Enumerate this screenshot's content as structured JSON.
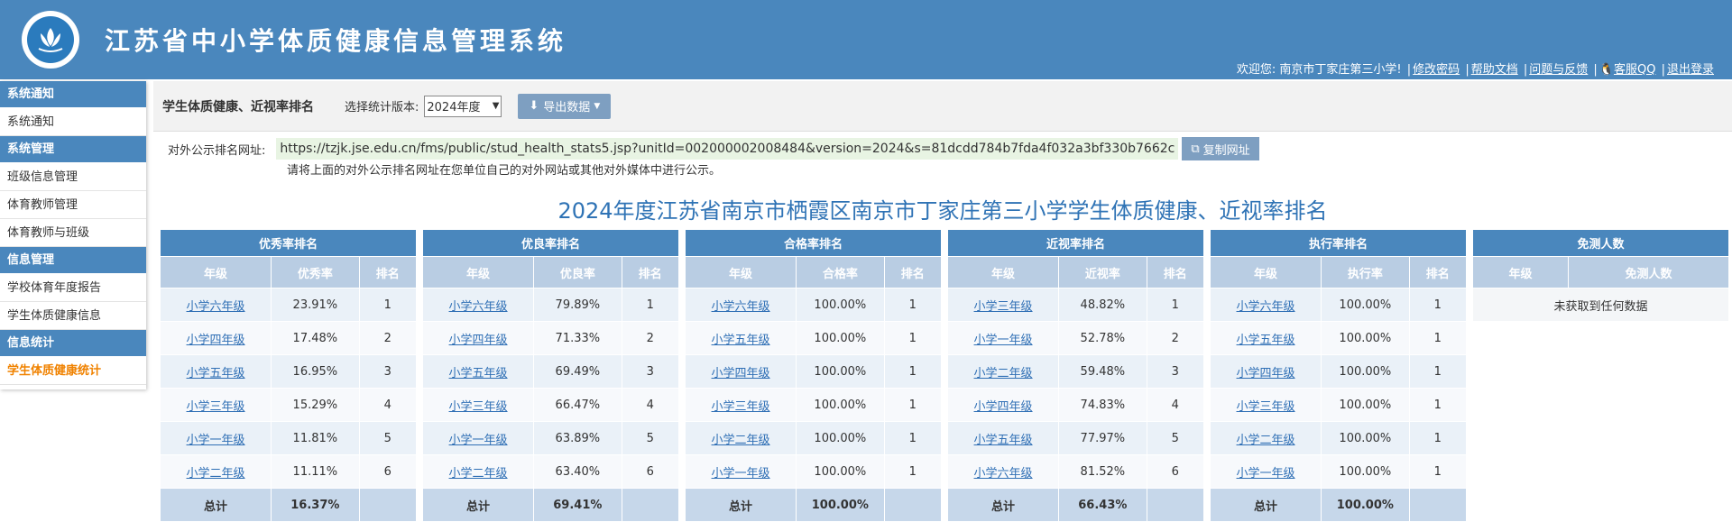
{
  "header": {
    "title": "江苏省中小学体质健康信息管理系统",
    "welcome": "欢迎您: 南京市丁家庄第三小学!",
    "links": [
      "修改密码",
      "帮助文档",
      "问题与反馈",
      "客服QQ",
      "退出登录"
    ]
  },
  "sidebar": [
    {
      "type": "head",
      "label": "系统通知"
    },
    {
      "type": "item",
      "label": "系统通知"
    },
    {
      "type": "head",
      "label": "系统管理"
    },
    {
      "type": "item",
      "label": "班级信息管理"
    },
    {
      "type": "item",
      "label": "体育教师管理"
    },
    {
      "type": "item",
      "label": "体育教师与班级"
    },
    {
      "type": "head",
      "label": "信息管理"
    },
    {
      "type": "item",
      "label": "学校体育年度报告"
    },
    {
      "type": "item",
      "label": "学生体质健康信息"
    },
    {
      "type": "head",
      "label": "信息统计"
    },
    {
      "type": "item",
      "label": "学生体质健康统计",
      "active": true
    }
  ],
  "toolbar": {
    "title": "学生体质健康、近视率排名",
    "version_label": "选择统计版本:",
    "version_value": "2024年度",
    "export_label": "导出数据"
  },
  "url": {
    "label": "对外公示排名网址:",
    "value": "https://tzjk.jse.edu.cn/fms/public/stud_health_stats5.jsp?unitId=002000002008484&version=2024&s=81dcdd784b7fda4f032a3bf330b7662c",
    "copy_label": "复制网址",
    "hint": "请将上面的对外公示排名网址在您单位自己的对外网站或其他对外媒体中进行公示。"
  },
  "page_title": "2024年度江苏省南京市栖霞区南京市丁家庄第三小学学生体质健康、近视率排名",
  "tables": [
    {
      "caption": "优秀率排名",
      "cols": [
        "年级",
        "优秀率",
        "排名"
      ],
      "rows": [
        [
          "小学六年级",
          "23.91%",
          "1"
        ],
        [
          "小学四年级",
          "17.48%",
          "2"
        ],
        [
          "小学五年级",
          "16.95%",
          "3"
        ],
        [
          "小学三年级",
          "15.29%",
          "4"
        ],
        [
          "小学一年级",
          "11.81%",
          "5"
        ],
        [
          "小学二年级",
          "11.11%",
          "6"
        ]
      ],
      "total": [
        "总计",
        "16.37%",
        ""
      ]
    },
    {
      "caption": "优良率排名",
      "cols": [
        "年级",
        "优良率",
        "排名"
      ],
      "rows": [
        [
          "小学六年级",
          "79.89%",
          "1"
        ],
        [
          "小学四年级",
          "71.33%",
          "2"
        ],
        [
          "小学五年级",
          "69.49%",
          "3"
        ],
        [
          "小学三年级",
          "66.47%",
          "4"
        ],
        [
          "小学一年级",
          "63.89%",
          "5"
        ],
        [
          "小学二年级",
          "63.40%",
          "6"
        ]
      ],
      "total": [
        "总计",
        "69.41%",
        ""
      ]
    },
    {
      "caption": "合格率排名",
      "cols": [
        "年级",
        "合格率",
        "排名"
      ],
      "rows": [
        [
          "小学六年级",
          "100.00%",
          "1"
        ],
        [
          "小学五年级",
          "100.00%",
          "1"
        ],
        [
          "小学四年级",
          "100.00%",
          "1"
        ],
        [
          "小学三年级",
          "100.00%",
          "1"
        ],
        [
          "小学二年级",
          "100.00%",
          "1"
        ],
        [
          "小学一年级",
          "100.00%",
          "1"
        ]
      ],
      "total": [
        "总计",
        "100.00%",
        ""
      ]
    },
    {
      "caption": "近视率排名",
      "cols": [
        "年级",
        "近视率",
        "排名"
      ],
      "rows": [
        [
          "小学三年级",
          "48.82%",
          "1"
        ],
        [
          "小学一年级",
          "52.78%",
          "2"
        ],
        [
          "小学二年级",
          "59.48%",
          "3"
        ],
        [
          "小学四年级",
          "74.83%",
          "4"
        ],
        [
          "小学五年级",
          "77.97%",
          "5"
        ],
        [
          "小学六年级",
          "81.52%",
          "6"
        ]
      ],
      "total": [
        "总计",
        "66.43%",
        ""
      ]
    },
    {
      "caption": "执行率排名",
      "cols": [
        "年级",
        "执行率",
        "排名"
      ],
      "rows": [
        [
          "小学六年级",
          "100.00%",
          "1"
        ],
        [
          "小学五年级",
          "100.00%",
          "1"
        ],
        [
          "小学四年级",
          "100.00%",
          "1"
        ],
        [
          "小学三年级",
          "100.00%",
          "1"
        ],
        [
          "小学二年级",
          "100.00%",
          "1"
        ],
        [
          "小学一年级",
          "100.00%",
          "1"
        ]
      ],
      "total": [
        "总计",
        "100.00%",
        ""
      ]
    }
  ],
  "exempt": {
    "caption": "免测人数",
    "cols": [
      "年级",
      "免测人数"
    ],
    "empty": "未获取到任何数据"
  }
}
